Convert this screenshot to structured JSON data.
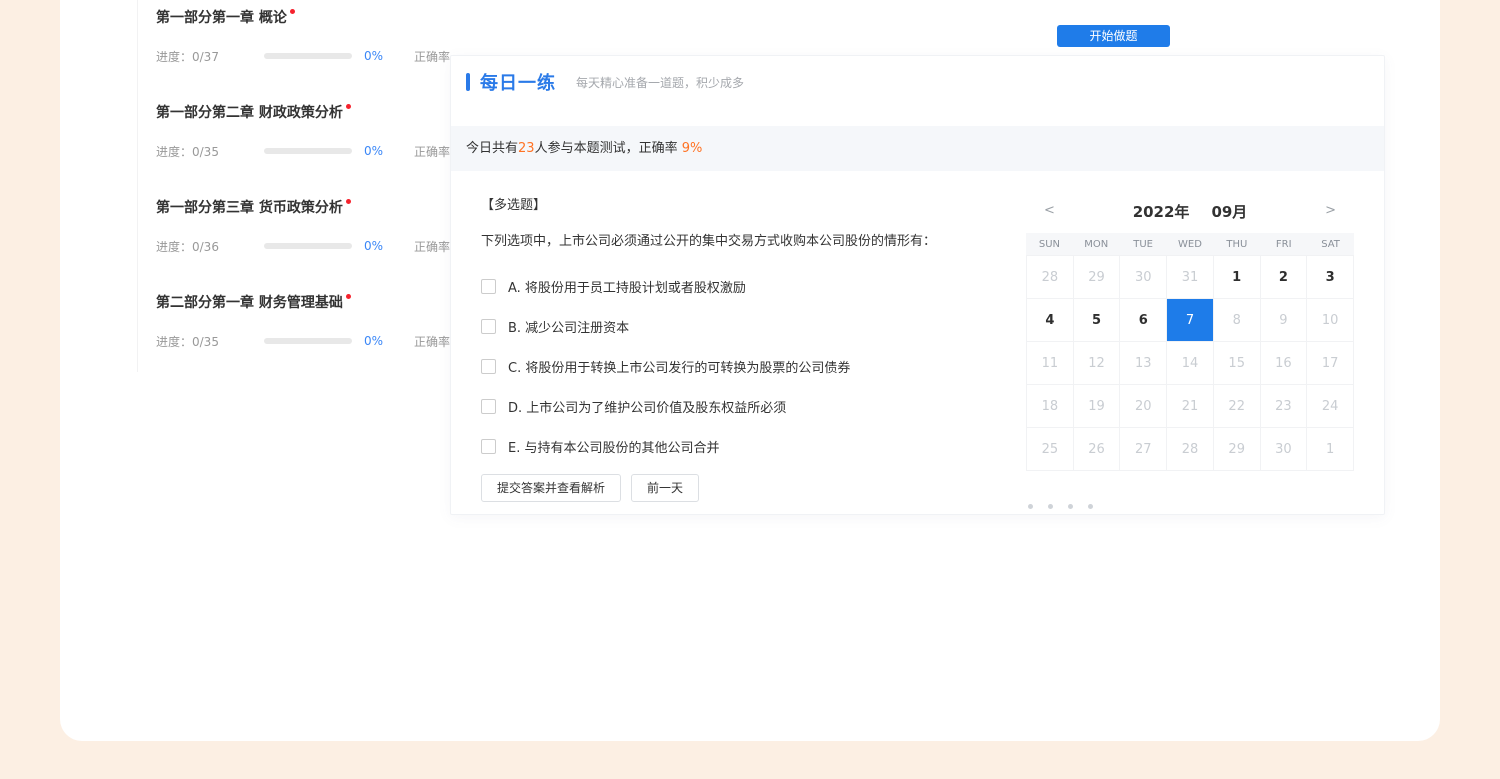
{
  "colors": {
    "accent_blue": "#1e7ce9",
    "title_blue": "#2a7ae8",
    "highlight_orange": "#ff7324",
    "notify_red": "#f5222d",
    "page_background": "#fcefe3"
  },
  "course": {
    "start_button": "开始做题",
    "chapters": [
      {
        "title": "第一部分第一章 概论",
        "progress": "进度：0/37",
        "percent": "0%",
        "accuracy": "正确率"
      },
      {
        "title": "第一部分第二章 财政政策分析",
        "progress": "进度：0/35",
        "percent": "0%",
        "accuracy": "正确率"
      },
      {
        "title": "第一部分第三章 货币政策分析",
        "progress": "进度：0/36",
        "percent": "0%",
        "accuracy": "正确率"
      },
      {
        "title": "第二部分第一章 财务管理基础",
        "progress": "进度：0/35",
        "percent": "0%",
        "accuracy": "正确率"
      }
    ]
  },
  "daily": {
    "title": "每日一练",
    "subtitle": "每天精心准备一道题，积少成多",
    "stats": {
      "prefix": "今日共有",
      "count": "23",
      "middle": "人参与本题测试，正确率 ",
      "rate": "9%"
    },
    "question": {
      "type_label": "【多选题】",
      "text": "下列选项中，上市公司必须通过公开的集中交易方式收购本公司股份的情形有：",
      "options": [
        "A. 将股份用于员工持股计划或者股权激励",
        "B. 减少公司注册资本",
        "C. 将股份用于转换上市公司发行的可转换为股票的公司债券",
        "D. 上市公司为了维护公司价值及股东权益所必须",
        "E. 与持有本公司股份的其他公司合并"
      ],
      "submit_label": "提交答案并查看解析",
      "prev_label": "前一天"
    },
    "calendar": {
      "year": "2022年",
      "month": "09月",
      "prev_icon": "<",
      "next_icon": ">",
      "weekdays": [
        "SUN",
        "MON",
        "TUE",
        "WED",
        "THU",
        "FRI",
        "SAT"
      ],
      "days": [
        {
          "d": "28",
          "s": "muted"
        },
        {
          "d": "29",
          "s": "muted"
        },
        {
          "d": "30",
          "s": "muted"
        },
        {
          "d": "31",
          "s": "muted"
        },
        {
          "d": "1",
          "s": "current"
        },
        {
          "d": "2",
          "s": "current"
        },
        {
          "d": "3",
          "s": "current"
        },
        {
          "d": "4",
          "s": "current"
        },
        {
          "d": "5",
          "s": "current"
        },
        {
          "d": "6",
          "s": "current"
        },
        {
          "d": "7",
          "s": "selected"
        },
        {
          "d": "8",
          "s": "muted"
        },
        {
          "d": "9",
          "s": "muted"
        },
        {
          "d": "10",
          "s": "muted"
        },
        {
          "d": "11",
          "s": "muted"
        },
        {
          "d": "12",
          "s": "muted"
        },
        {
          "d": "13",
          "s": "muted"
        },
        {
          "d": "14",
          "s": "muted"
        },
        {
          "d": "15",
          "s": "muted"
        },
        {
          "d": "16",
          "s": "muted"
        },
        {
          "d": "17",
          "s": "muted"
        },
        {
          "d": "18",
          "s": "muted"
        },
        {
          "d": "19",
          "s": "muted"
        },
        {
          "d": "20",
          "s": "muted"
        },
        {
          "d": "21",
          "s": "muted"
        },
        {
          "d": "22",
          "s": "muted"
        },
        {
          "d": "23",
          "s": "muted"
        },
        {
          "d": "24",
          "s": "muted"
        },
        {
          "d": "25",
          "s": "muted"
        },
        {
          "d": "26",
          "s": "muted"
        },
        {
          "d": "27",
          "s": "muted"
        },
        {
          "d": "28",
          "s": "muted"
        },
        {
          "d": "29",
          "s": "muted"
        },
        {
          "d": "30",
          "s": "muted"
        },
        {
          "d": "1",
          "s": "muted"
        }
      ]
    }
  }
}
